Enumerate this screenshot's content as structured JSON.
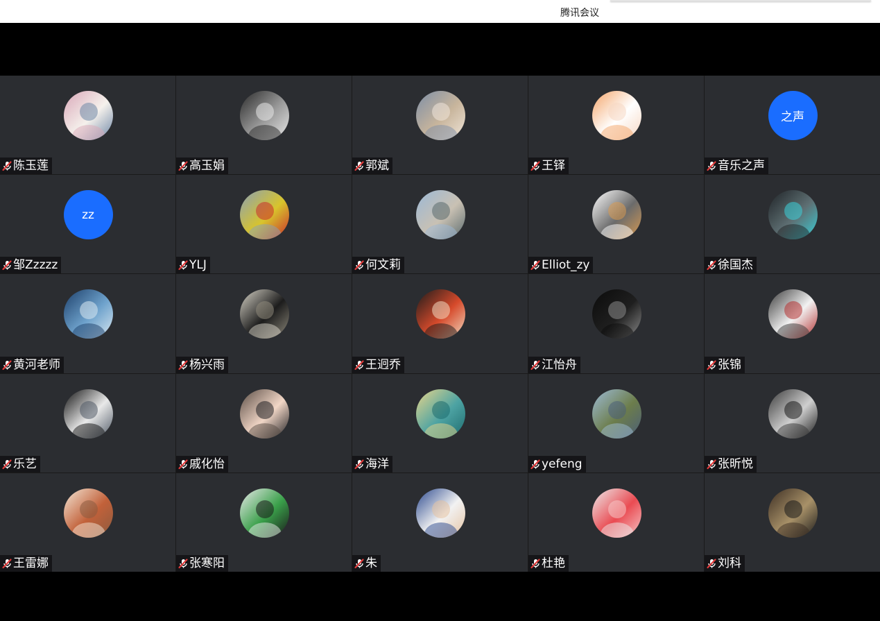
{
  "window": {
    "title": "腾讯会议"
  },
  "colors": {
    "tile_bg": "#2b2d31",
    "letter_avatar_bg": "#1a6dff",
    "mic_muted": "#e23b3b"
  },
  "participants": [
    {
      "name": "陈玉莲",
      "avatar": {
        "type": "photo",
        "palette": [
          "#d9a7b8",
          "#f5f1ec",
          "#6d86a6"
        ]
      }
    },
    {
      "name": "高玉娟",
      "avatar": {
        "type": "photo",
        "palette": [
          "#2a2a2a",
          "#9b9b9b",
          "#e8e8e8"
        ]
      }
    },
    {
      "name": "郭斌",
      "avatar": {
        "type": "photo",
        "palette": [
          "#7d8ea6",
          "#c8b59c",
          "#f0e6da"
        ]
      }
    },
    {
      "name": "王铎",
      "avatar": {
        "type": "photo",
        "palette": [
          "#f4a56a",
          "#ffffff",
          "#f6d7c2"
        ]
      }
    },
    {
      "name": "音乐之声",
      "avatar": {
        "type": "letter",
        "text": "之声"
      }
    },
    {
      "name": "邹Zzzzz",
      "avatar": {
        "type": "letter",
        "text": "zz"
      }
    },
    {
      "name": "YLJ",
      "avatar": {
        "type": "photo",
        "palette": [
          "#8aa0b5",
          "#d8c42c",
          "#c82b2b"
        ]
      }
    },
    {
      "name": "何文莉",
      "avatar": {
        "type": "photo",
        "palette": [
          "#9bb8d6",
          "#c9c1b3",
          "#5a6a6e"
        ]
      }
    },
    {
      "name": "Elliot_zy",
      "avatar": {
        "type": "photo",
        "palette": [
          "#ffffff",
          "#6b6b6b",
          "#d89a52"
        ]
      }
    },
    {
      "name": "徐国杰",
      "avatar": {
        "type": "photo",
        "palette": [
          "#1f2326",
          "#5e6f73",
          "#3ad0d8"
        ]
      }
    },
    {
      "name": "黄河老师",
      "avatar": {
        "type": "photo",
        "palette": [
          "#1d3f6a",
          "#6ea2cc",
          "#d9e7f0"
        ]
      }
    },
    {
      "name": "杨兴雨",
      "avatar": {
        "type": "photo",
        "palette": [
          "#d8d4c8",
          "#1c1c1c",
          "#8f8a7c"
        ]
      }
    },
    {
      "name": "王迥乔",
      "avatar": {
        "type": "photo",
        "palette": [
          "#1b1b1b",
          "#d64a2b",
          "#f0d9c0"
        ]
      }
    },
    {
      "name": "江怡舟",
      "avatar": {
        "type": "photo",
        "palette": [
          "#0b0b0b",
          "#1f1f1f",
          "#8a8a8a"
        ]
      }
    },
    {
      "name": "张锦",
      "avatar": {
        "type": "photo",
        "palette": [
          "#3a3a3a",
          "#f2f2f2",
          "#b33131"
        ]
      }
    },
    {
      "name": "乐艺",
      "avatar": {
        "type": "photo",
        "palette": [
          "#111111",
          "#e9e9e9",
          "#505a66"
        ]
      }
    },
    {
      "name": "戚化怡",
      "avatar": {
        "type": "photo",
        "palette": [
          "#5a4d45",
          "#f1d6c6",
          "#1f1f22"
        ]
      }
    },
    {
      "name": "海洋",
      "avatar": {
        "type": "photo",
        "palette": [
          "#e7d58a",
          "#4da3a3",
          "#1e6b6e"
        ]
      }
    },
    {
      "name": "yefeng",
      "avatar": {
        "type": "photo",
        "palette": [
          "#9dbbd6",
          "#6c7d4b",
          "#4b5e7a"
        ]
      }
    },
    {
      "name": "张昕悦",
      "avatar": {
        "type": "photo",
        "palette": [
          "#3a3a3a",
          "#cfcfcf",
          "#1a1a1a"
        ]
      }
    },
    {
      "name": "王雷娜",
      "avatar": {
        "type": "photo",
        "palette": [
          "#f3e6d6",
          "#c2613a",
          "#8b5b3f"
        ]
      }
    },
    {
      "name": "张寒阳",
      "avatar": {
        "type": "photo",
        "palette": [
          "#e9e9e9",
          "#3aa04a",
          "#1a1a1a"
        ]
      }
    },
    {
      "name": "朱",
      "avatar": {
        "type": "photo",
        "palette": [
          "#2c4a8f",
          "#f2f2f2",
          "#e5c3a3"
        ]
      }
    },
    {
      "name": "杜艳",
      "avatar": {
        "type": "photo",
        "palette": [
          "#ececec",
          "#ea4b52",
          "#f5c6c7"
        ]
      }
    },
    {
      "name": "刘科",
      "avatar": {
        "type": "photo",
        "palette": [
          "#3c2e23",
          "#a89168",
          "#1a1a1a"
        ]
      }
    }
  ]
}
